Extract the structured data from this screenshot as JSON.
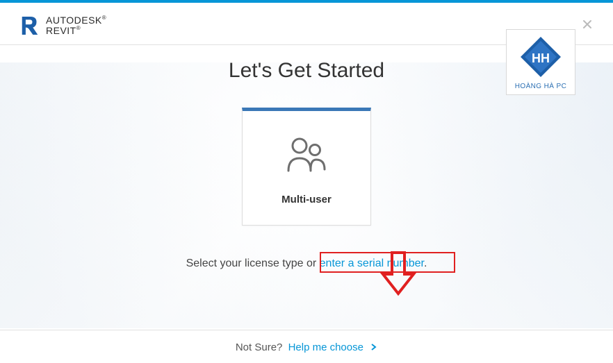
{
  "brand": {
    "line1": "AUTODESK",
    "line2": "REVIT"
  },
  "watermark": {
    "label": "HOÀNG HÀ PC"
  },
  "title": "Let's Get Started",
  "option": {
    "label": "Multi-user"
  },
  "license_prompt": {
    "prefix": "Select your license type or ",
    "link": "enter a serial number",
    "suffix": "."
  },
  "footer": {
    "not_sure": "Not Sure?",
    "help_link": "Help me choose"
  }
}
